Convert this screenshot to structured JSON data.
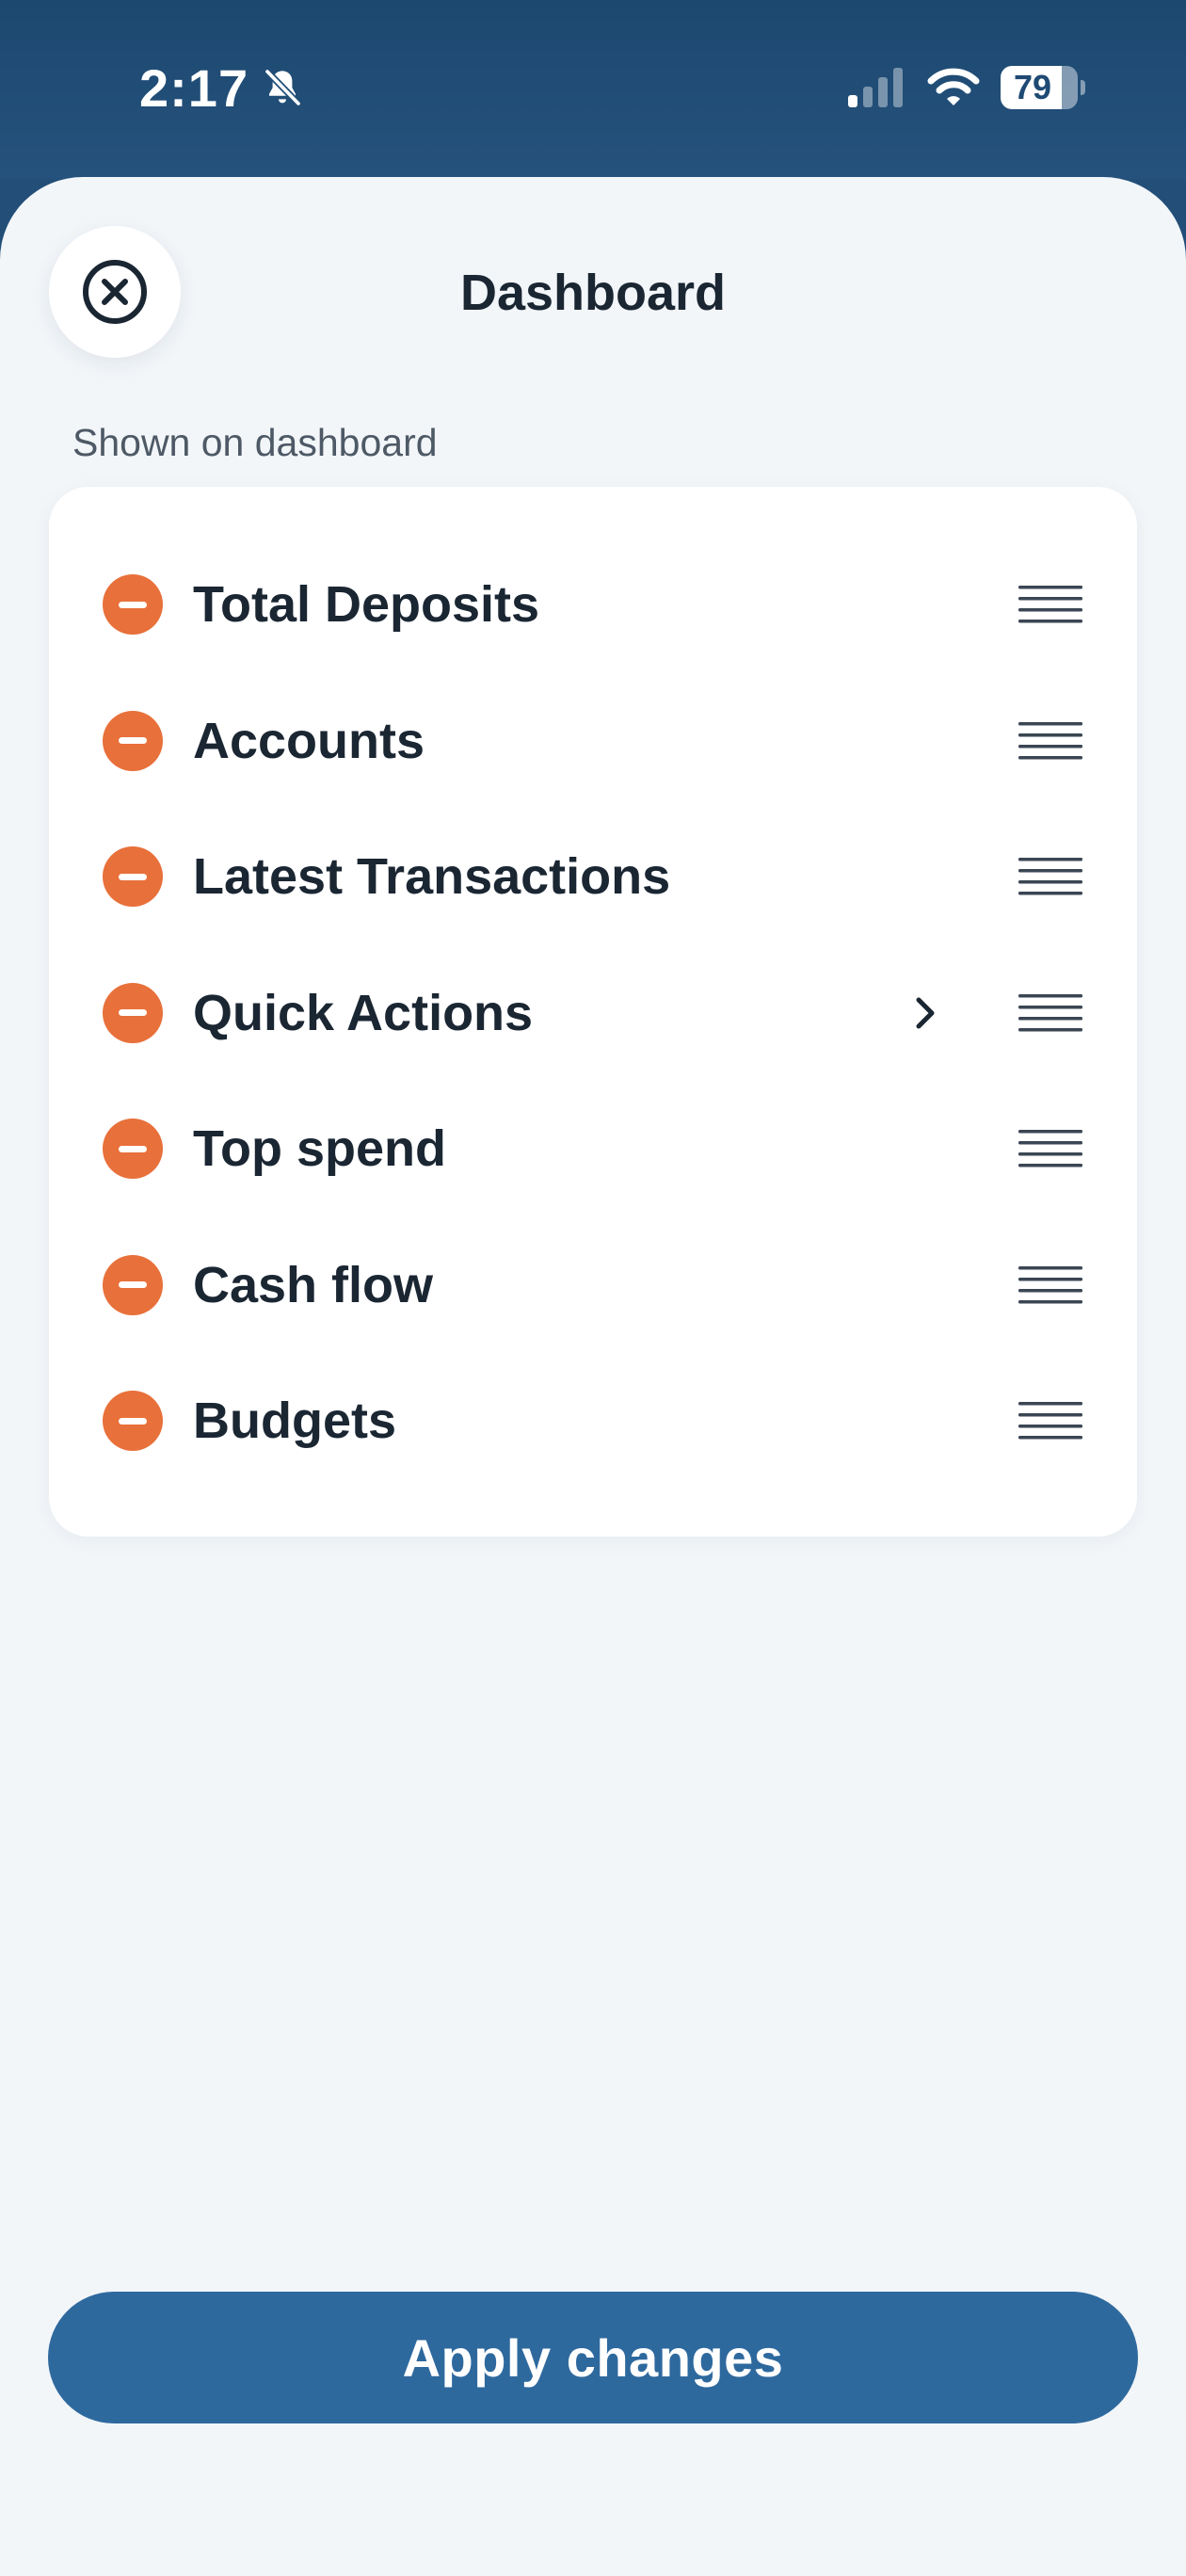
{
  "status_bar": {
    "time": "2:17",
    "battery_percent": "79",
    "battery_level": 0.79,
    "icons": [
      "bell-slash-icon",
      "cellular-signal-icon",
      "wifi-icon",
      "battery-icon"
    ]
  },
  "sheet": {
    "title": "Dashboard",
    "close_icon": "close-circle-icon"
  },
  "section": {
    "label": "Shown on dashboard"
  },
  "items": [
    {
      "label": "Total Deposits",
      "has_chevron": false
    },
    {
      "label": "Accounts",
      "has_chevron": false
    },
    {
      "label": "Latest Transactions",
      "has_chevron": false
    },
    {
      "label": "Quick Actions",
      "has_chevron": true
    },
    {
      "label": "Top spend",
      "has_chevron": false
    },
    {
      "label": "Cash flow",
      "has_chevron": false
    },
    {
      "label": "Budgets",
      "has_chevron": false
    }
  ],
  "apply_button": {
    "label": "Apply changes"
  },
  "colors": {
    "header_background": "#224e78",
    "sheet_background": "#f2f6f9",
    "remove_icon": "#e8703a",
    "primary_button": "#2e699e",
    "text_primary": "#1b2633"
  }
}
